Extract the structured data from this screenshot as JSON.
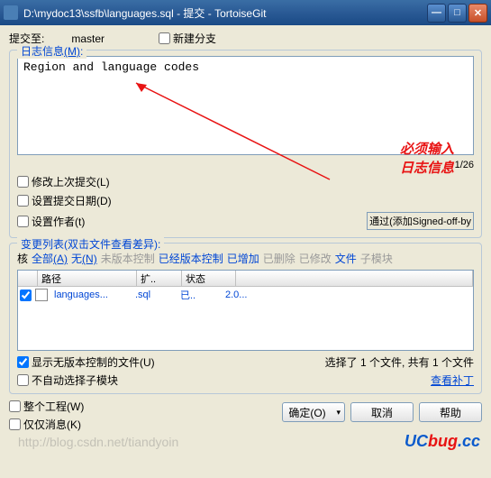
{
  "titlebar": {
    "text": "D:\\mydoc13\\ssfb\\languages.sql - 提交 - TortoiseGit"
  },
  "commit": {
    "to_label": "提交至:",
    "branch": "master",
    "new_branch_label": "新建分支"
  },
  "log": {
    "group_title": "日志信息",
    "group_key": "(M)",
    "message": "Region and language codes",
    "counter": "1/26",
    "amend_label": "修改上次提交(L)",
    "set_date_label": "设置提交日期(D)",
    "set_author_label": "设置作者(t)",
    "signoff_label": "通过(添加Signed-off-by"
  },
  "annotation": {
    "line1": "必须输入",
    "line2": "日志信息"
  },
  "changes": {
    "group_title": "变更列表",
    "group_hint": "(双击文件查看差异)",
    "filters": {
      "check": "核",
      "all": "全部",
      "all_key": "(A)",
      "none": "无",
      "none_key": "(N)",
      "unversioned": "未版本控制",
      "versioned": "已经版本控制",
      "added": "已增加",
      "deleted": "已删除",
      "modified": "已修改",
      "files": "文件",
      "submodules": "子模块"
    },
    "columns": {
      "path": "路径",
      "ext": "扩..",
      "status": "状态"
    },
    "rows": [
      {
        "path": "languages...",
        "ext": ".sql",
        "status": "已..",
        "extra": "2.0..."
      }
    ],
    "show_unversioned": "显示无版本控制的文件(U)",
    "no_auto_submodule": "不自动选择子模块",
    "whole_project": "整个工程(W)",
    "msg_only": "仅仅消息(K)",
    "selection_status": "选择了 1 个文件, 共有 1 个文件",
    "view_patch": "查看补丁"
  },
  "buttons": {
    "ok": "确定(O)",
    "cancel": "取消",
    "help": "帮助"
  },
  "watermark": {
    "uc": "UC",
    "bug": "bug",
    "cc": ".cc",
    "blog": "http://blog.csdn.net/tiandyoin"
  }
}
